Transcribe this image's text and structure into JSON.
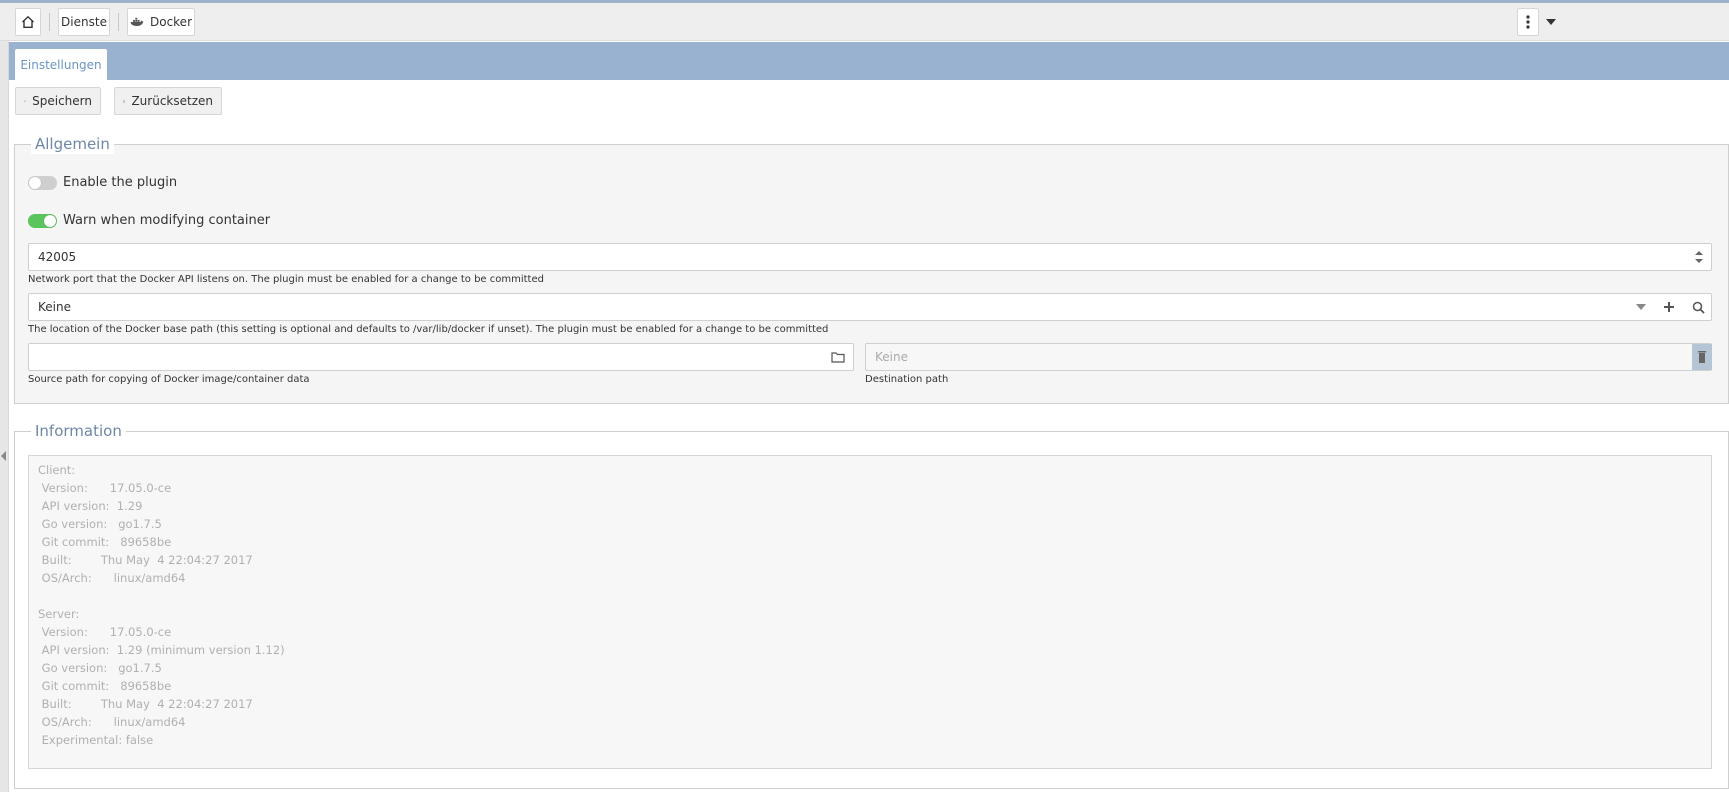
{
  "nav": {
    "services_label": "Dienste",
    "docker_label": "Docker"
  },
  "tabs": [
    {
      "label": "Einstellungen"
    }
  ],
  "toolbar": {
    "save_label": "Speichern",
    "reset_label": "Zurücksetzen"
  },
  "general": {
    "legend": "Allgemein",
    "enable_plugin_label": "Enable the plugin",
    "enable_plugin_on": false,
    "warn_label": "Warn when modifying container",
    "warn_on": true,
    "port_value": "42005",
    "port_hint": "Network port that the Docker API listens on. The plugin must be enabled for a change to be committed",
    "base_path_value": "Keine",
    "base_path_hint": "The location of the Docker base path (this setting is optional and defaults to /var/lib/docker if unset). The plugin must be enabled for a change to be committed",
    "source_path_value": "",
    "source_path_hint": "Source path for copying of Docker image/container data",
    "dest_path_placeholder": "Keine",
    "dest_path_hint": "Destination path"
  },
  "information": {
    "legend": "Information",
    "text": "Client:\n Version:      17.05.0-ce\n API version:  1.29\n Go version:   go1.7.5\n Git commit:   89658be\n Built:        Thu May  4 22:04:27 2017\n OS/Arch:      linux/amd64\n\nServer:\n Version:      17.05.0-ce\n API version:  1.29 (minimum version 1.12)\n Go version:   go1.7.5\n Git commit:   89658be\n Built:        Thu May  4 22:04:27 2017\n OS/Arch:      linux/amd64\n Experimental: false"
  },
  "colors": {
    "accent": "#98b2cf",
    "toggle_on": "#5cc45c",
    "toggle_off": "#cfcfcf"
  },
  "icons": [
    "home-icon",
    "docker-whale-icon",
    "kebab-menu-icon",
    "caret-down-icon",
    "check-icon",
    "refresh-icon",
    "spinner-icon",
    "dropdown-caret-icon",
    "plus-icon",
    "search-icon",
    "folder-icon",
    "trash-icon",
    "collapse-arrow-icon"
  ]
}
